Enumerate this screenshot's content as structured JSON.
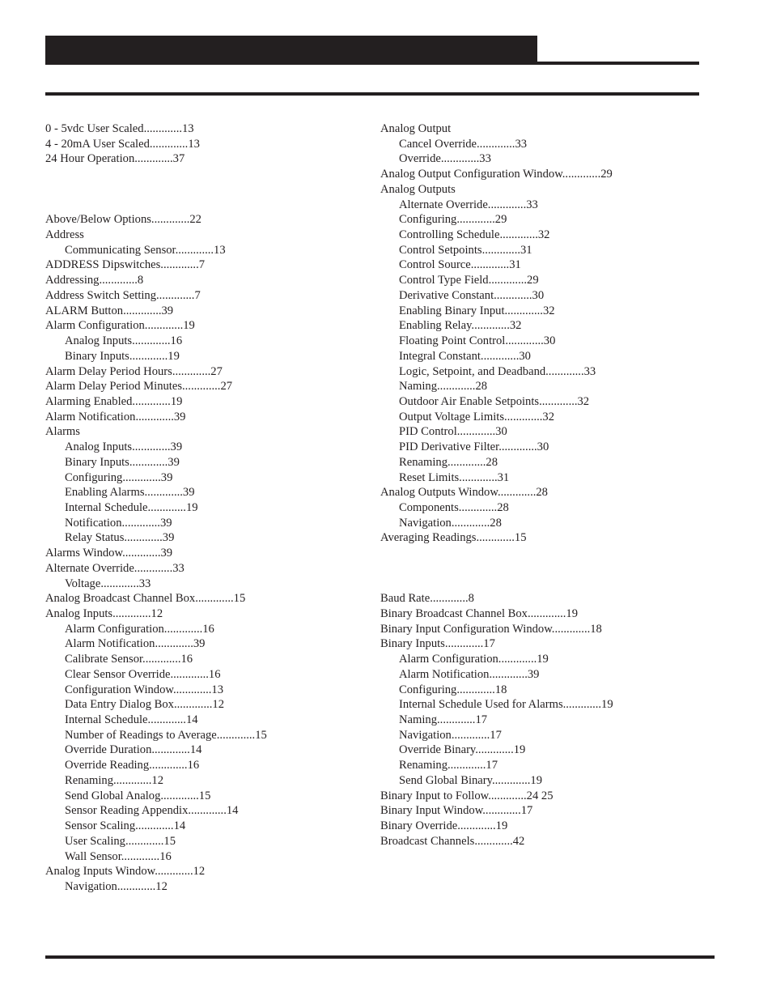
{
  "header": {
    "title": ""
  },
  "index": {
    "left_column": [
      {
        "type": "entry",
        "level": 0,
        "text": "0 - 5vdc User Scaled.............13"
      },
      {
        "type": "entry",
        "level": 0,
        "text": "4 - 20mA User Scaled.............13"
      },
      {
        "type": "entry",
        "level": 0,
        "text": "24 Hour Operation.............37"
      },
      {
        "type": "gap"
      },
      {
        "type": "gap"
      },
      {
        "type": "gap"
      },
      {
        "type": "entry",
        "level": 0,
        "text": "Above/Below Options.............22"
      },
      {
        "type": "entry",
        "level": 0,
        "text": "Address"
      },
      {
        "type": "entry",
        "level": 1,
        "text": "Communicating Sensor.............13"
      },
      {
        "type": "entry",
        "level": 0,
        "text": "ADDRESS Dipswitches.............7"
      },
      {
        "type": "entry",
        "level": 0,
        "text": "Addressing.............8"
      },
      {
        "type": "entry",
        "level": 0,
        "text": "Address Switch Setting.............7"
      },
      {
        "type": "entry",
        "level": 0,
        "text": "ALARM Button.............39"
      },
      {
        "type": "entry",
        "level": 0,
        "text": "Alarm Configuration.............19"
      },
      {
        "type": "entry",
        "level": 1,
        "text": "Analog Inputs.............16"
      },
      {
        "type": "entry",
        "level": 1,
        "text": "Binary Inputs.............19"
      },
      {
        "type": "entry",
        "level": 0,
        "text": "Alarm Delay Period Hours.............27"
      },
      {
        "type": "entry",
        "level": 0,
        "text": "Alarm Delay Period Minutes.............27"
      },
      {
        "type": "entry",
        "level": 0,
        "text": "Alarming Enabled.............19"
      },
      {
        "type": "entry",
        "level": 0,
        "text": "Alarm Notification.............39"
      },
      {
        "type": "entry",
        "level": 0,
        "text": "Alarms"
      },
      {
        "type": "entry",
        "level": 1,
        "text": "Analog Inputs.............39"
      },
      {
        "type": "entry",
        "level": 1,
        "text": "Binary Inputs.............39"
      },
      {
        "type": "entry",
        "level": 1,
        "text": "Configuring.............39"
      },
      {
        "type": "entry",
        "level": 1,
        "text": "Enabling Alarms.............39"
      },
      {
        "type": "entry",
        "level": 1,
        "text": "Internal Schedule.............19"
      },
      {
        "type": "entry",
        "level": 1,
        "text": "Notification.............39"
      },
      {
        "type": "entry",
        "level": 1,
        "text": "Relay Status.............39"
      },
      {
        "type": "entry",
        "level": 0,
        "text": "Alarms Window.............39"
      },
      {
        "type": "entry",
        "level": 0,
        "text": "Alternate Override.............33"
      },
      {
        "type": "entry",
        "level": 1,
        "text": "Voltage.............33"
      },
      {
        "type": "entry",
        "level": 0,
        "text": "Analog Broadcast Channel Box.............15"
      },
      {
        "type": "entry",
        "level": 0,
        "text": "Analog Inputs.............12"
      },
      {
        "type": "entry",
        "level": 1,
        "text": "Alarm Configuration.............16"
      },
      {
        "type": "entry",
        "level": 1,
        "text": "Alarm Notification.............39"
      },
      {
        "type": "entry",
        "level": 1,
        "text": "Calibrate Sensor.............16"
      },
      {
        "type": "entry",
        "level": 1,
        "text": "Clear Sensor Override.............16"
      },
      {
        "type": "entry",
        "level": 1,
        "text": "Configuration Window.............13"
      },
      {
        "type": "entry",
        "level": 1,
        "text": "Data Entry Dialog Box.............12"
      },
      {
        "type": "entry",
        "level": 1,
        "text": "Internal Schedule.............14"
      },
      {
        "type": "entry",
        "level": 1,
        "text": "Number of Readings to Average.............15"
      },
      {
        "type": "entry",
        "level": 1,
        "text": "Override Duration.............14"
      },
      {
        "type": "entry",
        "level": 1,
        "text": "Override Reading.............16"
      },
      {
        "type": "entry",
        "level": 1,
        "text": "Renaming.............12"
      },
      {
        "type": "entry",
        "level": 1,
        "text": "Send Global Analog.............15"
      },
      {
        "type": "entry",
        "level": 1,
        "text": "Sensor Reading Appendix.............14"
      },
      {
        "type": "entry",
        "level": 1,
        "text": "Sensor Scaling.............14"
      },
      {
        "type": "entry",
        "level": 1,
        "text": "User Scaling.............15"
      },
      {
        "type": "entry",
        "level": 1,
        "text": "Wall Sensor.............16"
      },
      {
        "type": "entry",
        "level": 0,
        "text": "Analog Inputs Window.............12"
      },
      {
        "type": "entry",
        "level": 1,
        "text": "Navigation.............12"
      }
    ],
    "right_column": [
      {
        "type": "entry",
        "level": 0,
        "text": "Analog Output"
      },
      {
        "type": "entry",
        "level": 1,
        "text": "Cancel Override.............33"
      },
      {
        "type": "entry",
        "level": 1,
        "text": "Override.............33"
      },
      {
        "type": "entry",
        "level": 0,
        "text": "Analog Output Configuration Window.............29"
      },
      {
        "type": "entry",
        "level": 0,
        "text": "Analog Outputs"
      },
      {
        "type": "entry",
        "level": 1,
        "text": "Alternate Override.............33"
      },
      {
        "type": "entry",
        "level": 1,
        "text": "Configuring.............29"
      },
      {
        "type": "entry",
        "level": 1,
        "text": "Controlling Schedule.............32"
      },
      {
        "type": "entry",
        "level": 1,
        "text": "Control Setpoints.............31"
      },
      {
        "type": "entry",
        "level": 1,
        "text": "Control Source.............31"
      },
      {
        "type": "entry",
        "level": 1,
        "text": "Control Type Field.............29"
      },
      {
        "type": "entry",
        "level": 1,
        "text": "Derivative Constant.............30"
      },
      {
        "type": "entry",
        "level": 1,
        "text": "Enabling Binary Input.............32"
      },
      {
        "type": "entry",
        "level": 1,
        "text": "Enabling Relay.............32"
      },
      {
        "type": "entry",
        "level": 1,
        "text": "Floating Point Control.............30"
      },
      {
        "type": "entry",
        "level": 1,
        "text": "Integral Constant.............30"
      },
      {
        "type": "entry",
        "level": 1,
        "text": "Logic, Setpoint, and Deadband.............33"
      },
      {
        "type": "entry",
        "level": 1,
        "text": "Naming.............28"
      },
      {
        "type": "entry",
        "level": 1,
        "text": "Outdoor Air Enable Setpoints.............32"
      },
      {
        "type": "entry",
        "level": 1,
        "text": "Output Voltage Limits.............32"
      },
      {
        "type": "entry",
        "level": 1,
        "text": "PID Control.............30"
      },
      {
        "type": "entry",
        "level": 1,
        "text": "PID Derivative Filter.............30"
      },
      {
        "type": "entry",
        "level": 1,
        "text": "Renaming.............28"
      },
      {
        "type": "entry",
        "level": 1,
        "text": "Reset Limits.............31"
      },
      {
        "type": "entry",
        "level": 0,
        "text": "Analog Outputs Window.............28"
      },
      {
        "type": "entry",
        "level": 1,
        "text": "Components.............28"
      },
      {
        "type": "entry",
        "level": 1,
        "text": "Navigation.............28"
      },
      {
        "type": "entry",
        "level": 0,
        "text": "Averaging Readings.............15"
      },
      {
        "type": "gap"
      },
      {
        "type": "gap"
      },
      {
        "type": "gap"
      },
      {
        "type": "entry",
        "level": 0,
        "text": "Baud Rate.............8"
      },
      {
        "type": "entry",
        "level": 0,
        "text": "Binary Broadcast Channel Box.............19"
      },
      {
        "type": "entry",
        "level": 0,
        "text": "Binary Input Configuration Window.............18"
      },
      {
        "type": "entry",
        "level": 0,
        "text": "Binary Inputs.............17"
      },
      {
        "type": "entry",
        "level": 1,
        "text": "Alarm Configuration.............19"
      },
      {
        "type": "entry",
        "level": 1,
        "text": "Alarm Notification.............39"
      },
      {
        "type": "entry",
        "level": 1,
        "text": "Configuring.............18"
      },
      {
        "type": "entry",
        "level": 1,
        "text": "Internal Schedule Used for Alarms.............19"
      },
      {
        "type": "entry",
        "level": 1,
        "text": "Naming.............17"
      },
      {
        "type": "entry",
        "level": 1,
        "text": "Navigation.............17"
      },
      {
        "type": "entry",
        "level": 1,
        "text": "Override Binary.............19"
      },
      {
        "type": "entry",
        "level": 1,
        "text": "Renaming.............17"
      },
      {
        "type": "entry",
        "level": 1,
        "text": "Send Global Binary.............19"
      },
      {
        "type": "entry",
        "level": 0,
        "text": "Binary Input to Follow.............24 25"
      },
      {
        "type": "entry",
        "level": 0,
        "text": "Binary Input Window.............17"
      },
      {
        "type": "entry",
        "level": 0,
        "text": "Binary Override.............19"
      },
      {
        "type": "entry",
        "level": 0,
        "text": "Broadcast Channels.............42"
      }
    ]
  }
}
